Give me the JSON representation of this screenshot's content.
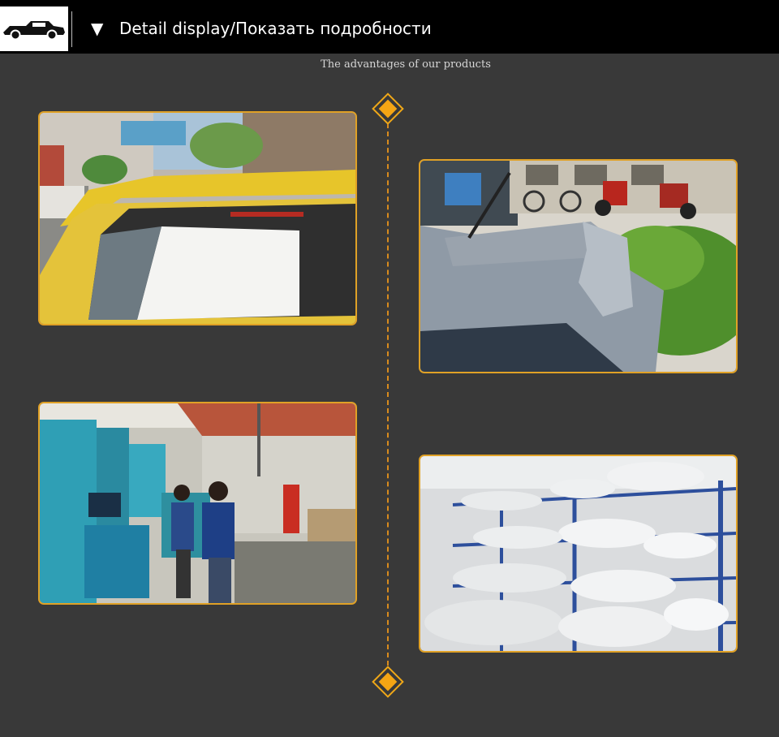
{
  "header": {
    "logo_icon": "car-silhouette-icon",
    "arrow_icon": "triangle-down-icon",
    "arrow_glyph": "▼",
    "title": "Detail display/Показать подробности"
  },
  "subtitle": "The advantages of our products",
  "timeline": {
    "accent_color": "#f4a514",
    "line_color": "#d98b1d",
    "marker_icon": "diamond-icon"
  },
  "photos": [
    {
      "id": "yellow-spoiler-photo",
      "depicts": "rear-spoiler-on-yellow-hatchback"
    },
    {
      "id": "grey-spoiler-photo",
      "depicts": "rear-spoiler-on-grey-hatchback"
    },
    {
      "id": "factory-photo",
      "depicts": "factory-workers-with-machines"
    },
    {
      "id": "warehouse-photo",
      "depicts": "warehouse-shelves-with-wrapped-spoilers"
    }
  ],
  "colors": {
    "background": "#393939",
    "header_bg": "#000000",
    "photo_border": "#e0a126"
  }
}
